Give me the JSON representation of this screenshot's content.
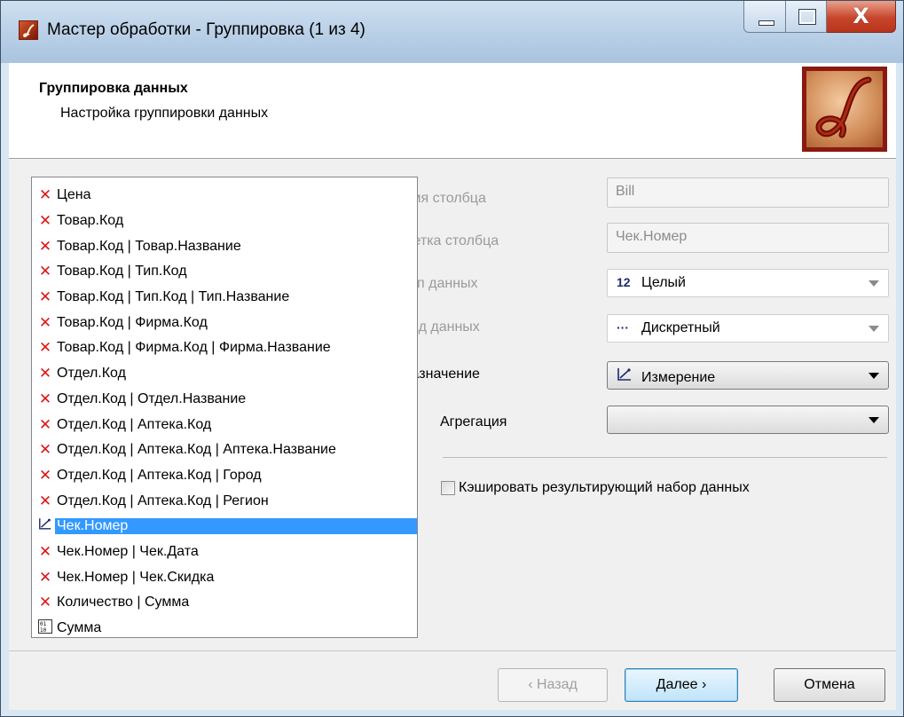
{
  "window": {
    "title": "Мастер обработки - Группировка (1 из 4)",
    "buttons": {
      "minimize": "_",
      "maximize": "□",
      "close": "X"
    }
  },
  "header": {
    "title": "Группировка данных",
    "subtitle": "Настройка группировки данных"
  },
  "form": {
    "column_name_label": "Имя столбца",
    "column_name_value": "Bill",
    "column_label_label": "Метка столбца",
    "column_label_value": "Чек.Номер",
    "data_type_label": "Тип данных",
    "data_type_value": "Целый",
    "data_type_icon": "12",
    "data_kind_label": "Вид данных",
    "data_kind_value": "Дискретный",
    "data_kind_icon": "···",
    "purpose_label": "Назначение",
    "purpose_value": "Измерение",
    "aggregation_label": "Агрегация",
    "aggregation_value": "",
    "cache_label": "Кэшировать результирующий набор данных",
    "cache_checked": false
  },
  "list": {
    "items": [
      {
        "label": "Цена",
        "icon": "red-x"
      },
      {
        "label": "Товар.Код",
        "icon": "red-x"
      },
      {
        "label": "Товар.Код | Товар.Название",
        "icon": "red-x"
      },
      {
        "label": "Товар.Код | Тип.Код",
        "icon": "red-x"
      },
      {
        "label": "Товар.Код | Тип.Код | Тип.Название",
        "icon": "red-x"
      },
      {
        "label": "Товар.Код | Фирма.Код",
        "icon": "red-x"
      },
      {
        "label": "Товар.Код | Фирма.Код | Фирма.Название",
        "icon": "red-x"
      },
      {
        "label": "Отдел.Код",
        "icon": "red-x"
      },
      {
        "label": "Отдел.Код | Отдел.Название",
        "icon": "red-x"
      },
      {
        "label": "Отдел.Код | Аптека.Код",
        "icon": "red-x"
      },
      {
        "label": "Отдел.Код | Аптека.Код | Аптека.Название",
        "icon": "red-x"
      },
      {
        "label": "Отдел.Код | Аптека.Код | Город",
        "icon": "red-x"
      },
      {
        "label": "Отдел.Код | Аптека.Код | Регион",
        "icon": "red-x"
      },
      {
        "label": "Чек.Номер",
        "icon": "dimension",
        "selected": true
      },
      {
        "label": "Чек.Номер | Чек.Дата",
        "icon": "red-x"
      },
      {
        "label": "Чек.Номер | Чек.Скидка",
        "icon": "red-x"
      },
      {
        "label": "Количество | Сумма",
        "icon": "red-x"
      },
      {
        "label": "Сумма",
        "icon": "measure"
      }
    ]
  },
  "footer": {
    "back_label": "‹ Назад",
    "next_label": "Далее ›",
    "cancel_label": "Отмена"
  },
  "colors": {
    "selection": "#3399ff",
    "error_mark": "#e01515",
    "close_button": "#c7452a"
  }
}
